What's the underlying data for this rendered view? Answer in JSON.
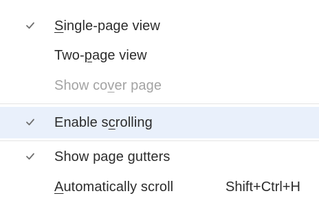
{
  "menu": {
    "items": [
      {
        "pre": "",
        "mn": "S",
        "post": "ingle-page view",
        "checked": true,
        "disabled": false,
        "highlighted": false,
        "shortcut": ""
      },
      {
        "pre": "Two-",
        "mn": "p",
        "post": "age view",
        "checked": false,
        "disabled": false,
        "highlighted": false,
        "shortcut": ""
      },
      {
        "pre": "Show co",
        "mn": "v",
        "post": "er page",
        "checked": false,
        "disabled": true,
        "highlighted": false,
        "shortcut": ""
      },
      {
        "pre": "Enable s",
        "mn": "c",
        "post": "rolling",
        "checked": true,
        "disabled": false,
        "highlighted": true,
        "shortcut": ""
      },
      {
        "pre": "Show page gutters",
        "mn": "",
        "post": "",
        "checked": true,
        "disabled": false,
        "highlighted": false,
        "shortcut": ""
      },
      {
        "pre": "",
        "mn": "A",
        "post": "utomatically scroll",
        "checked": false,
        "disabled": false,
        "highlighted": false,
        "shortcut": "Shift+Ctrl+H"
      }
    ]
  },
  "colors": {
    "text": "#2c2c2c",
    "disabled_text": "#a3a3a3",
    "highlight_bg": "#e9f0fb",
    "checkmark": "#6e6e6e",
    "divider": "#e4e4e4"
  },
  "icons": {
    "check": "checkmark-icon"
  }
}
